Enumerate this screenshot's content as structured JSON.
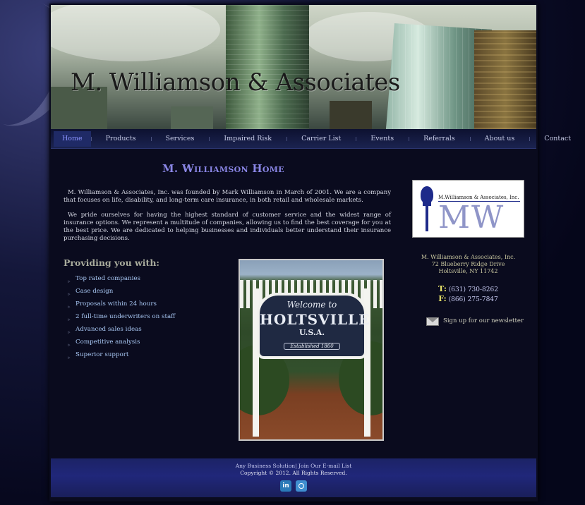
{
  "header": {
    "site_title": "M. Williamson & Associates"
  },
  "nav": {
    "items": [
      {
        "label": "Home",
        "active": true
      },
      {
        "label": "Products"
      },
      {
        "label": "Services"
      },
      {
        "label": "Impaired Risk"
      },
      {
        "label": "Carrier List"
      },
      {
        "label": "Events"
      },
      {
        "label": "Referrals"
      },
      {
        "label": "About us"
      },
      {
        "label": "Contact"
      }
    ]
  },
  "main": {
    "page_title": "M. Williamson Home",
    "intro": [
      "M. Williamson & Associates, Inc. was founded by Mark Williamson in March of 2001. We are a company that focuses on life, disability, and long-term care insurance, in both retail and wholesale markets.",
      "We pride ourselves for having the highest standard of customer service and the widest range of insurance options. We represent a multitude of companies, allowing us to find the best coverage for you at the best price. We are dedicated to helping businesses and individuals better understand their insurance purchasing decisions."
    ],
    "providing_heading": "Providing you with:",
    "features": [
      "Top rated companies",
      "Case design",
      "Proposals within 24 hours",
      "2 full-time underwriters on staff",
      "Advanced sales ideas",
      "Competitive analysis",
      "Superior support"
    ],
    "photo": {
      "welcome": "Welcome to",
      "town": "HOLTSVILLE",
      "country": "U.S.A.",
      "established": "Established 1860"
    }
  },
  "sidebar": {
    "logo": {
      "company": "M.Williamson & Associates, Inc.",
      "monogram": "MW"
    },
    "contact": {
      "name": "M. Williamson & Associates, Inc.",
      "street": "72 Blueberry Ridge Drive",
      "city": "Holtsville, NY 11742",
      "phone_label": "T:",
      "phone": "(631) 730-8262",
      "fax_label": "F:",
      "fax": "(866) 275-7847"
    },
    "newsletter": "Sign up for our newsletter"
  },
  "footer": {
    "links": "Any Business Solution| Join Our E-mail List",
    "copyright": "Copyright © 2012. All Rights Reserved.",
    "social": [
      {
        "icon": "linkedin-icon",
        "glyph": "in"
      },
      {
        "icon": "camera-icon"
      }
    ]
  }
}
